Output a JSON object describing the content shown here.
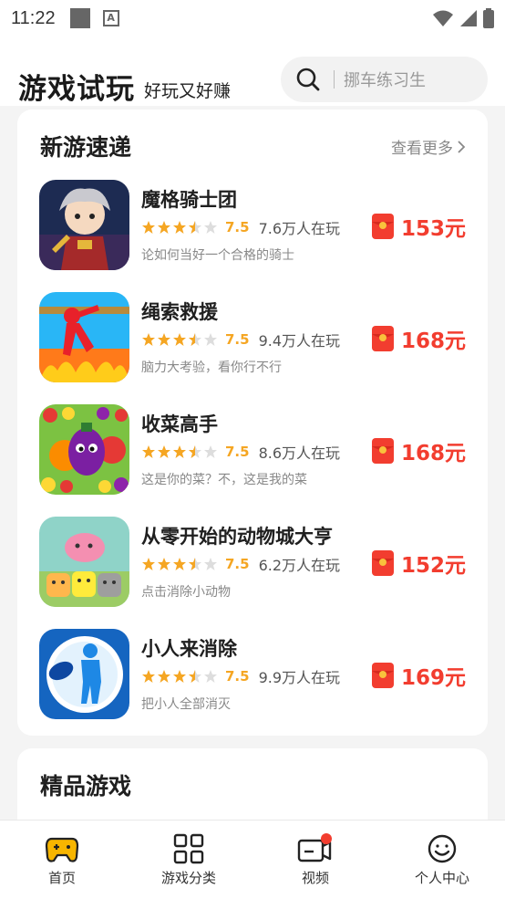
{
  "status_bar": {
    "time": "11:22"
  },
  "header": {
    "title": "游戏试玩",
    "subtitle": "好玩又好赚",
    "search_placeholder": "挪车练习生"
  },
  "new_games": {
    "title": "新游速递",
    "see_more": "查看更多",
    "games": [
      {
        "name": "魔格骑士团",
        "rating": "7.5",
        "players": "7.6万人在玩",
        "desc": "论如何当好一个合格的骑士",
        "reward": "153元",
        "stars": 3.5
      },
      {
        "name": "绳索救援",
        "rating": "7.5",
        "players": "9.4万人在玩",
        "desc": "脑力大考验，看你行不行",
        "reward": "168元",
        "stars": 3.5
      },
      {
        "name": "收菜高手",
        "rating": "7.5",
        "players": "8.6万人在玩",
        "desc": "这是你的菜？不，这是我的菜",
        "reward": "168元",
        "stars": 3.5
      },
      {
        "name": "从零开始的动物城大亨",
        "rating": "7.5",
        "players": "6.2万人在玩",
        "desc": "点击消除小动物",
        "reward": "152元",
        "stars": 3.5
      },
      {
        "name": "小人来消除",
        "rating": "7.5",
        "players": "9.9万人在玩",
        "desc": "把小人全部消灭",
        "reward": "169元",
        "stars": 3.5
      }
    ]
  },
  "premium": {
    "title": "精品游戏"
  },
  "nav": {
    "items": [
      {
        "label": "首页",
        "icon": "gamepad-icon",
        "active": true
      },
      {
        "label": "游戏分类",
        "icon": "grid-icon",
        "active": false
      },
      {
        "label": "视频",
        "icon": "video-icon",
        "active": false
      },
      {
        "label": "个人中心",
        "icon": "smile-icon",
        "active": false
      }
    ]
  },
  "colors": {
    "accent": "#f23d2f",
    "star": "#f5a623",
    "gamepad": "#f7b500"
  }
}
